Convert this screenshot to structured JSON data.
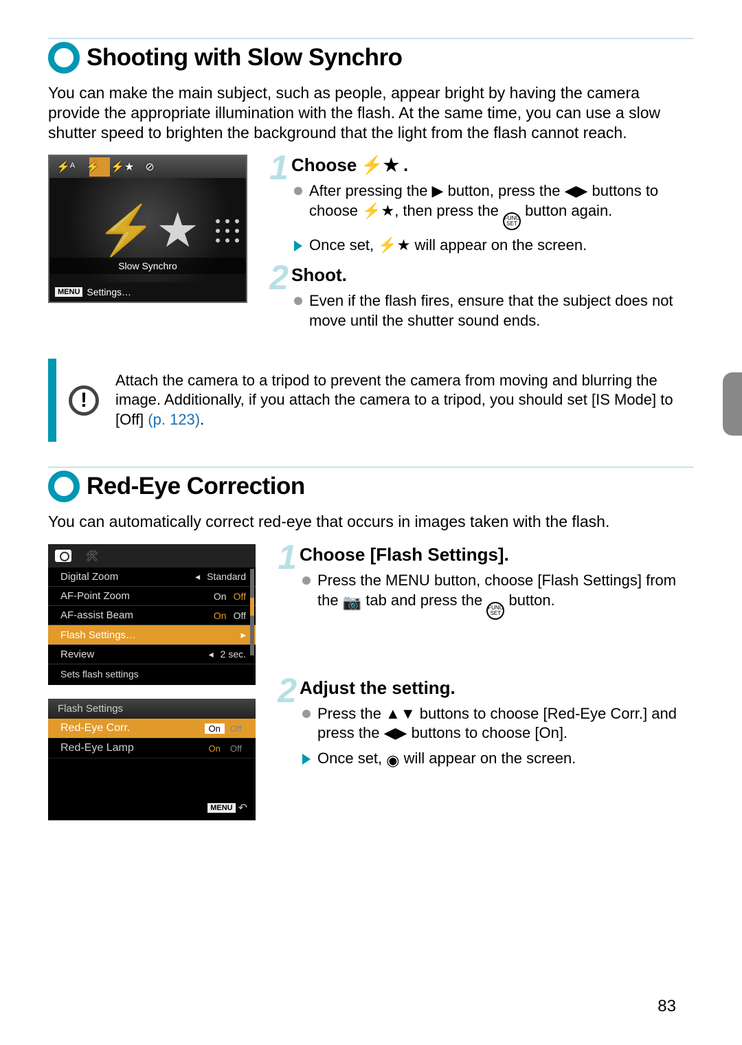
{
  "section1": {
    "title": "Shooting with Slow Synchro",
    "intro": "You can make the main subject, such as people, appear bright by having the camera provide the appropriate illumination with the flash. At the same time, you can use a slow shutter speed to brighten the background that the light from the flash cannot reach.",
    "screen": {
      "label": "Slow Synchro",
      "menu_btn": "MENU",
      "footer": "Settings…"
    },
    "step1": {
      "title_pre": "Choose ",
      "title_post": ".",
      "b1a": "After pressing the ",
      "b1b": " button, press the ",
      "b1c": " buttons to choose ",
      "b1d": ", then press the ",
      "b1e": " button again.",
      "b2a": "Once set, ",
      "b2b": " will appear on the screen."
    },
    "step2": {
      "title": "Shoot.",
      "b1": "Even if the flash fires, ensure that the subject does not move until the shutter sound ends."
    },
    "callout": "Attach the camera to a tripod to prevent the camera from moving and blurring the image. Additionally, if you attach the camera to a tripod, you should set [IS Mode] to [Off] ",
    "callout_link": "(p. 123)",
    "callout_end": "."
  },
  "section2": {
    "title": "Red-Eye Correction",
    "intro": "You can automatically correct red-eye that occurs in images taken with the flash.",
    "menu": {
      "rows": [
        {
          "label": "Digital Zoom",
          "value": "Standard"
        },
        {
          "label": "AF-Point Zoom",
          "on": "On",
          "off": "Off"
        },
        {
          "label": "AF-assist Beam",
          "on": "On",
          "off": "Off"
        },
        {
          "label": "Flash Settings…"
        },
        {
          "label": "Review",
          "value": "2 sec."
        }
      ],
      "help": "Sets flash settings"
    },
    "flash": {
      "title": "Flash Settings",
      "row1": "Red-Eye Corr.",
      "row2": "Red-Eye Lamp",
      "on": "On",
      "off": "Off",
      "menu": "MENU"
    },
    "step1": {
      "title": "Choose [Flash Settings].",
      "b1a": "Press the ",
      "b1_menu": "MENU",
      "b1b": " button, choose [Flash Settings] from the ",
      "b1c": " tab and press the ",
      "b1d": " button."
    },
    "step2": {
      "title": "Adjust the setting.",
      "b1a": "Press the ",
      "b1b": " buttons to choose [Red-Eye Corr.] and press the ",
      "b1c": " buttons to choose [On].",
      "b2a": "Once set, ",
      "b2b": " will appear on the screen."
    }
  },
  "page": "83"
}
